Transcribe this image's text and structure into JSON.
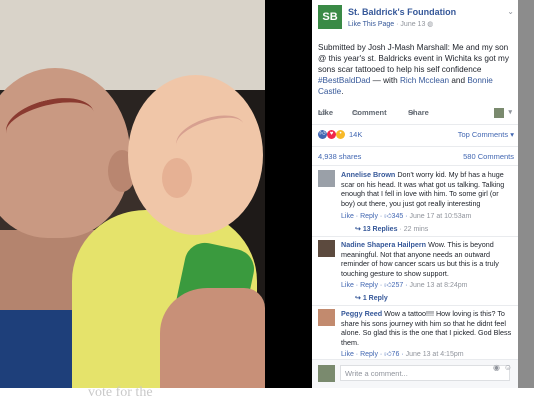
{
  "post": {
    "page_name": "St. Baldrick's Foundation",
    "logo_text": "SB",
    "like_page": "Like This Page",
    "date": "June 13",
    "text_main": "Submitted by Josh J-Mash Marshall: Me and my son @ this year's st. Baldricks event in Wichita ks got my sons scar tattooed to help his self confidence",
    "hashtag": "#BestBaldDad",
    "with_text": "— with",
    "tag1": "Rich Mcclean",
    "and_text": "and",
    "tag2": "Bonnie Castle",
    "actions": {
      "like": "Like",
      "comment": "Comment",
      "share": "Share"
    },
    "reactions_count": "14K",
    "top_comments": "Top Comments",
    "shares": "4,938 shares",
    "comments_count": "580 Comments"
  },
  "comments": [
    {
      "name": "Annelise Brown",
      "text": "Don't worry kid. My bf has a huge scar on his head. It was what got us talking. Talking enough that I fell in love with him. To some girl (or boy) out there, you just got really interesting",
      "like": "Like",
      "reply": "Reply",
      "likes": "345",
      "time": "June 17 at 10:53am",
      "replies": "13 Replies",
      "replies_time": "22 mins",
      "avatar_color": "#9aa0a8"
    },
    {
      "name": "Nadine Shapera Hailpern",
      "text": "Wow. This is beyond meaningful. Not that anyone needs an outward reminder of how cancer scars us but this is a truly touching gesture to show support.",
      "like": "Like",
      "reply": "Reply",
      "likes": "257",
      "time": "June 13 at 8:24pm",
      "replies": "1 Reply",
      "avatar_color": "#5c4a3e"
    },
    {
      "name": "Peggy Reed",
      "text": "Wow a tattoo!!!! How loving is this? To share his sons journey with him so that he didnt feel alone. So glad this is the one that I picked. God Bless them.",
      "like": "Like",
      "reply": "Reply",
      "likes": "76",
      "time": "June 13 at 4:15pm",
      "avatar_color": "#c28a6e"
    }
  ],
  "composer": {
    "placeholder": "Write a comment..."
  },
  "photo_caption": "vote for the",
  "colors": {
    "brand": "#3a8a46",
    "link": "#365899",
    "accent": "#4267b2"
  }
}
